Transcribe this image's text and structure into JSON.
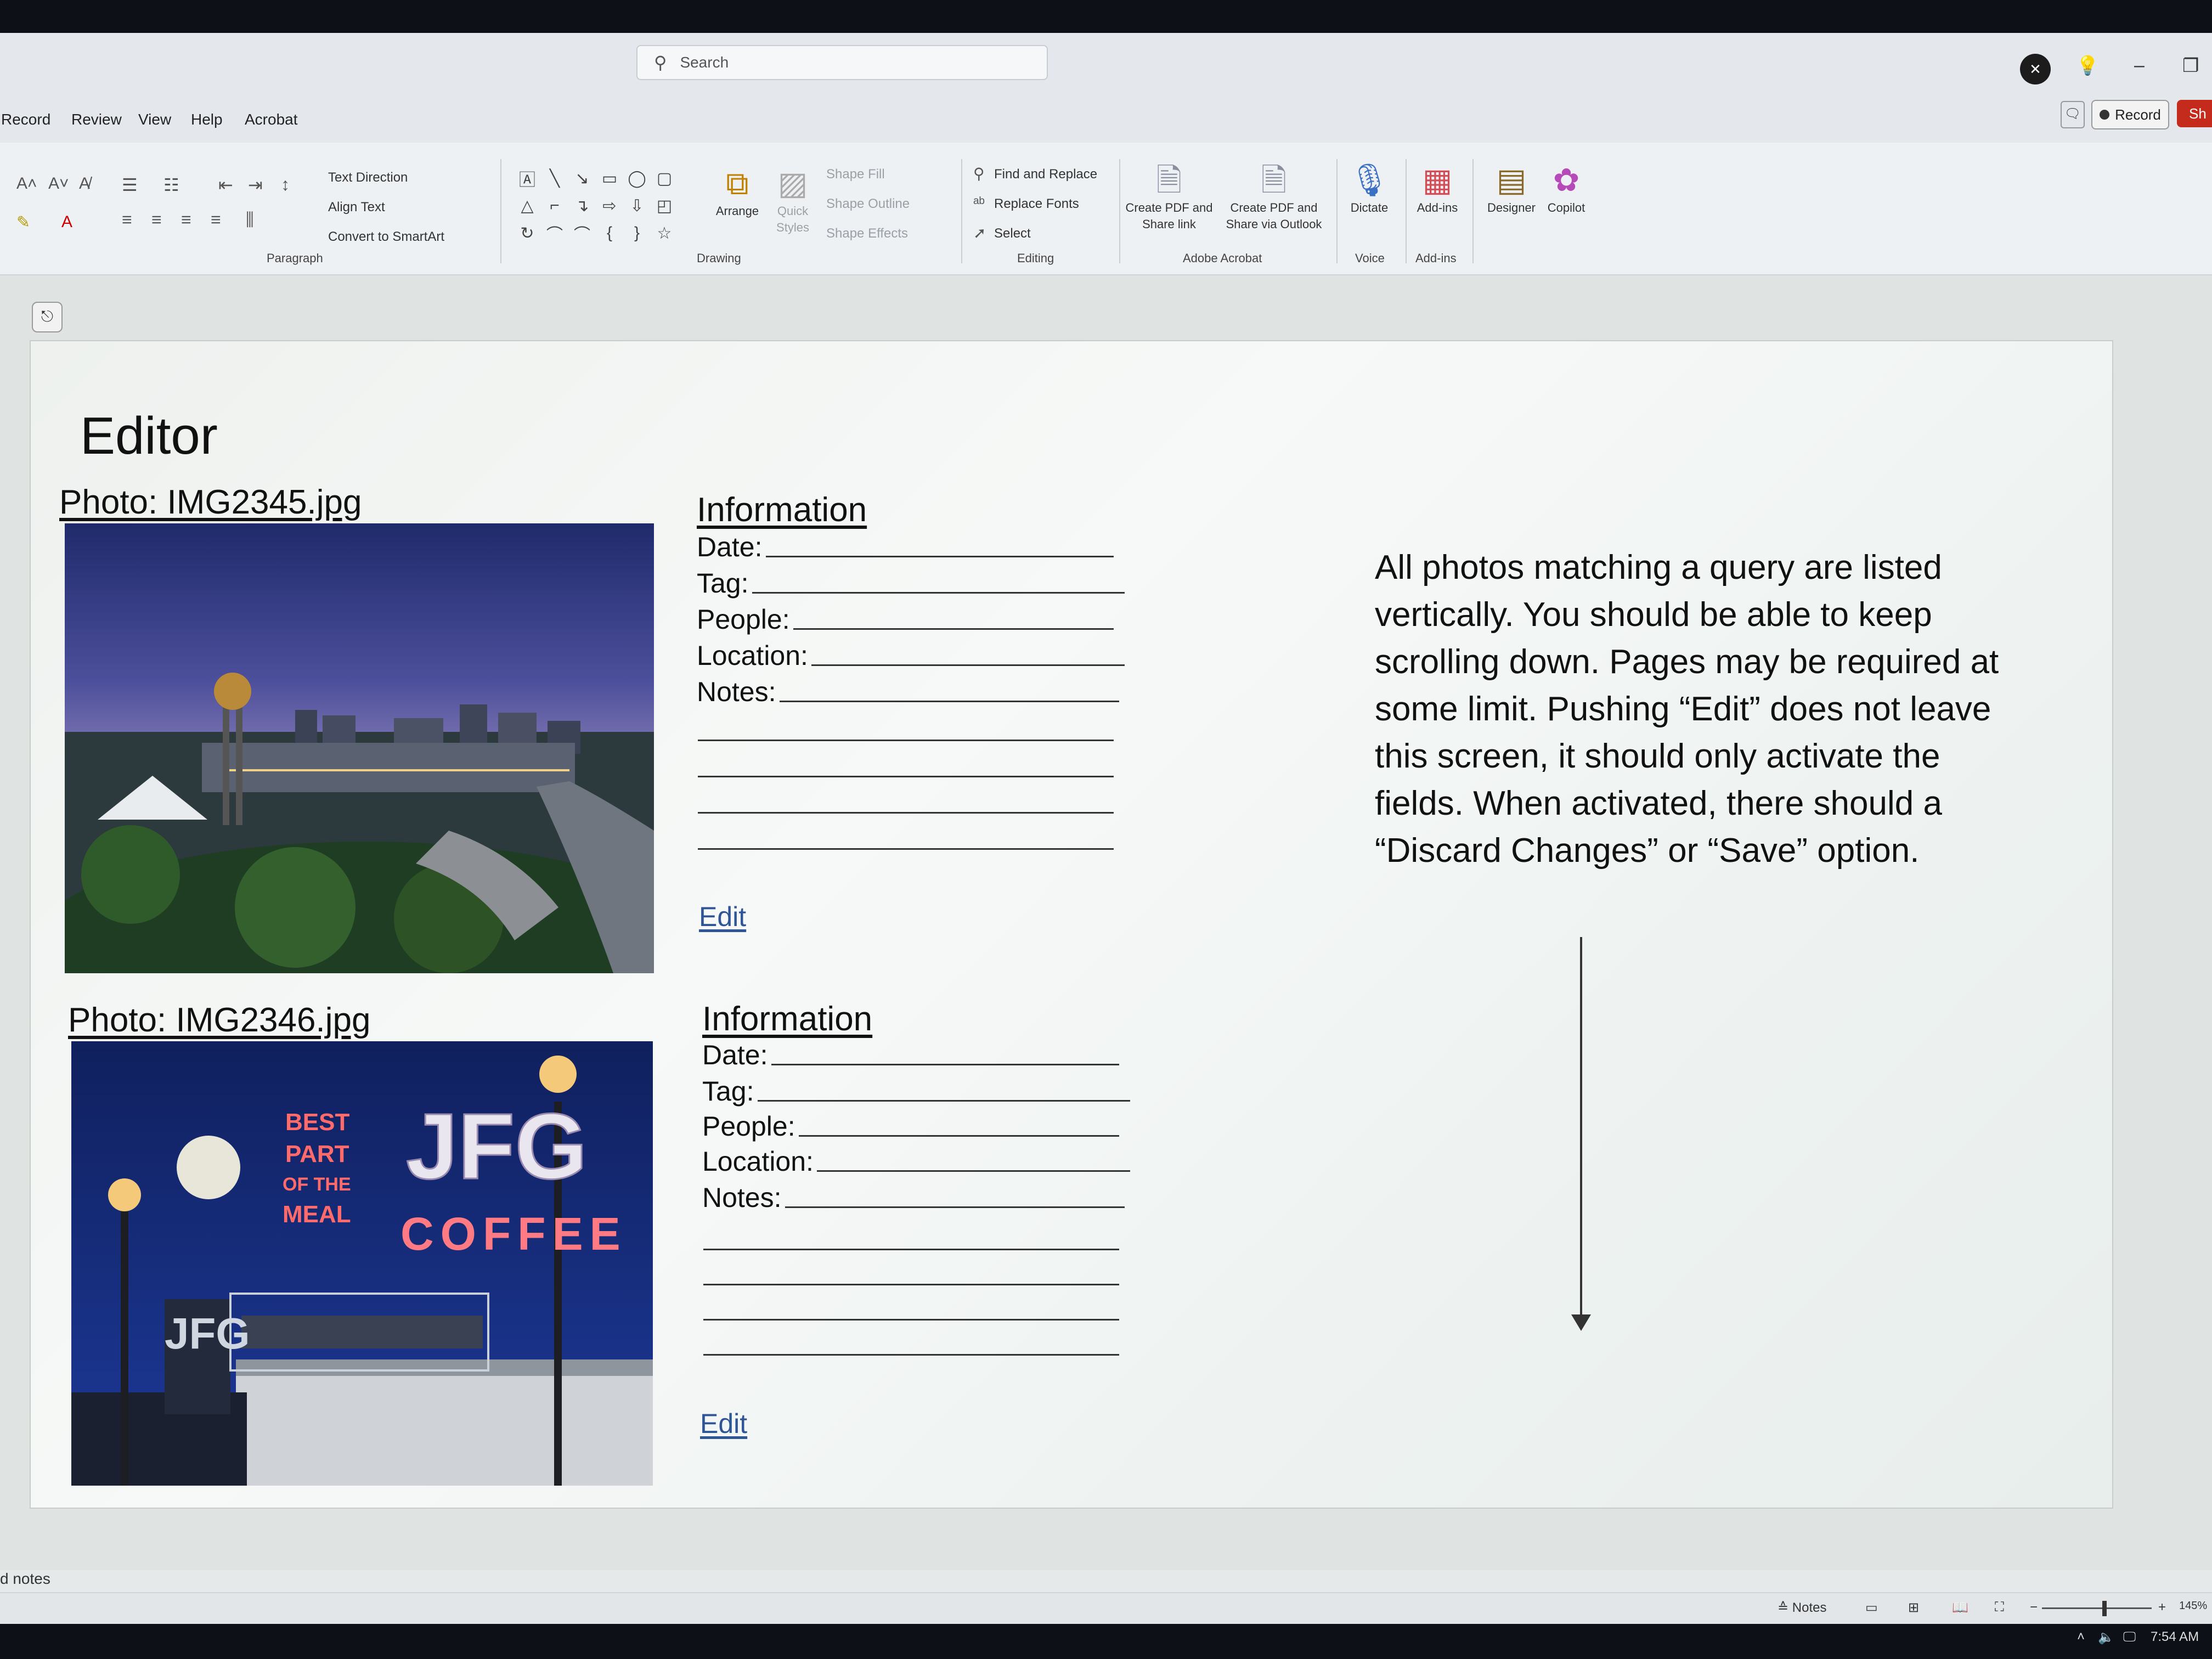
{
  "titlebar": {
    "search_placeholder": "Search"
  },
  "menu": [
    "Record",
    "Review",
    "View",
    "Help",
    "Acrobat"
  ],
  "top_right": {
    "record_label": "Record",
    "share_label": "Sh"
  },
  "ribbon": {
    "paragraph_label": "Paragraph",
    "text_direction": "Text Direction",
    "align_text": "Align Text",
    "convert_smartart": "Convert to SmartArt",
    "drawing_label": "Drawing",
    "arrange": "Arrange",
    "quick_styles": "Quick Styles",
    "shape_fill": "Shape Fill",
    "shape_outline": "Shape Outline",
    "shape_effects": "Shape Effects",
    "editing_label": "Editing",
    "find_replace": "Find and Replace",
    "replace_fonts": "Replace Fonts",
    "select": "Select",
    "adobe_label": "Adobe Acrobat",
    "create_pdf_share": "Create PDF and Share link",
    "create_pdf_outlook": "Create PDF and Share via Outlook",
    "voice_label": "Voice",
    "dictate": "Dictate",
    "addins_label": "Add-ins",
    "addins": "Add-ins",
    "designer": "Designer",
    "copilot": "Copilot"
  },
  "slide": {
    "title": "Editor",
    "photos": [
      {
        "label": "Photo: IMG2345.jpg",
        "info_heading": "Information",
        "fields": [
          "Date:",
          "Tag:",
          "People:",
          "Location:",
          "Notes:"
        ],
        "edit": "Edit"
      },
      {
        "label": "Photo: IMG2346.jpg",
        "info_heading": "Information",
        "fields": [
          "Date:",
          "Tag:",
          "People:",
          "Location:",
          "Notes:"
        ],
        "edit": "Edit",
        "sign_text": {
          "best": "BEST",
          "part": "PART",
          "of_the": "OF THE",
          "meal": "MEAL",
          "jfg": "JFG",
          "coffee": "COFFEE"
        }
      }
    ],
    "description": "All photos matching a query are listed vertically. You should be able to keep scrolling down. Pages may be required at some limit. Pushing “Edit” does not leave this screen, it should only activate the fields. When activated, there should a “Discard Changes” or “Save” option."
  },
  "notes_pane": "d notes",
  "status": {
    "notes": "Notes",
    "zoom": "145%"
  },
  "taskbar": {
    "time": "7:54 AM"
  }
}
